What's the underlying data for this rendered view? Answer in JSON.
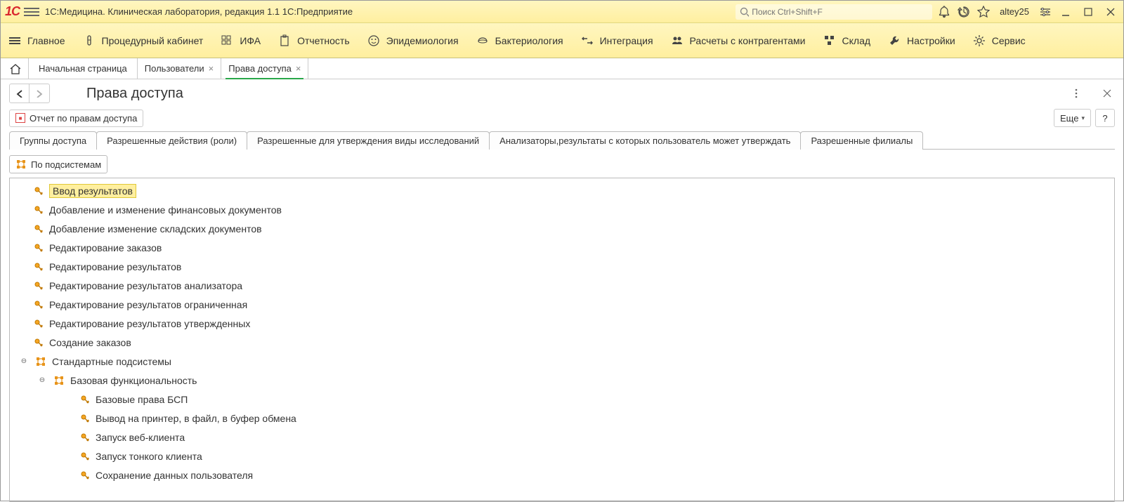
{
  "title_bar": {
    "app_title": "1С:Медицина. Клиническая лаборатория, редакция 1.1 1С:Предприятие",
    "search_placeholder": "Поиск Ctrl+Shift+F",
    "user": "altey25"
  },
  "main_menu": {
    "items": [
      "Главное",
      "Процедурный кабинет",
      "ИФА",
      "Отчетность",
      "Эпидемиология",
      "Бактериология",
      "Интеграция",
      "Расчеты с контрагентами",
      "Склад",
      "Настройки",
      "Сервис"
    ]
  },
  "open_tabs": {
    "home": "Начальная страница",
    "tabs": [
      {
        "label": "Пользователи"
      },
      {
        "label": "Права доступа",
        "active": true
      }
    ]
  },
  "page": {
    "title": "Права доступа",
    "report_button": "Отчет по правам доступа",
    "more_button": "Еще",
    "help_button": "?"
  },
  "inner_tabs": [
    "Группы доступа",
    "Разрешенные действия (роли)",
    "Разрешенные для утверждения виды исследований",
    "Анализаторы,результаты с которых пользователь может утверждать",
    "Разрешенные филиалы"
  ],
  "inner_tabs_active_index": 1,
  "toggle_button": "По подсистемам",
  "tree": [
    {
      "depth": 0,
      "icon": "key",
      "label": "Ввод результатов",
      "highlight": true
    },
    {
      "depth": 0,
      "icon": "key",
      "label": "Добавление и изменение финансовых документов"
    },
    {
      "depth": 0,
      "icon": "key",
      "label": "Добавление изменение складских документов"
    },
    {
      "depth": 0,
      "icon": "key",
      "label": "Редактирование заказов"
    },
    {
      "depth": 0,
      "icon": "key",
      "label": "Редактирование результатов"
    },
    {
      "depth": 0,
      "icon": "key",
      "label": "Редактирование результатов анализатора"
    },
    {
      "depth": 0,
      "icon": "key",
      "label": "Редактирование результатов ограниченная"
    },
    {
      "depth": 0,
      "icon": "key",
      "label": "Редактирование результатов утвержденных"
    },
    {
      "depth": 0,
      "icon": "key",
      "label": "Создание заказов"
    },
    {
      "depth": 0,
      "icon": "folder",
      "label": "Стандартные подсистемы",
      "expander": "minus"
    },
    {
      "depth": 1,
      "icon": "folder",
      "label": "Базовая функциональность",
      "expander": "minus"
    },
    {
      "depth": 2,
      "icon": "key",
      "label": "Базовые права БСП"
    },
    {
      "depth": 2,
      "icon": "key",
      "label": "Вывод на принтер, в файл, в буфер обмена"
    },
    {
      "depth": 2,
      "icon": "key",
      "label": "Запуск веб-клиента"
    },
    {
      "depth": 2,
      "icon": "key",
      "label": "Запуск тонкого клиента"
    },
    {
      "depth": 2,
      "icon": "key",
      "label": "Сохранение данных пользователя"
    }
  ]
}
